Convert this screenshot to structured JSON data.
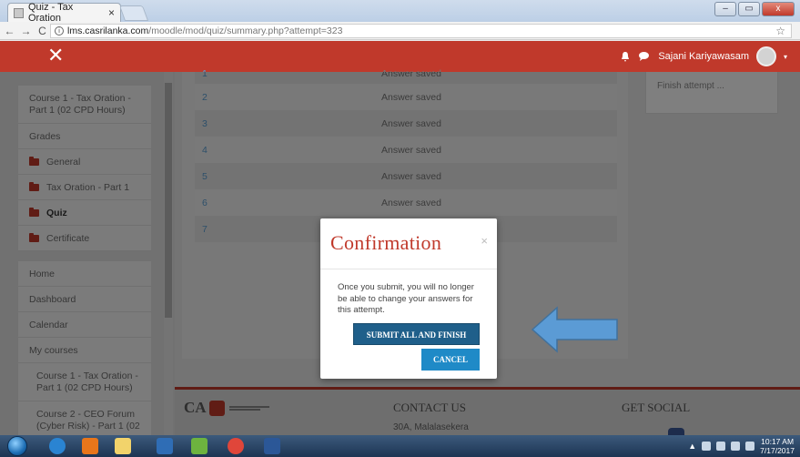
{
  "browser": {
    "tab_title": "Quiz - Tax Oration",
    "tab_close": "×",
    "window_title": "",
    "nav_back": "←",
    "nav_forward": "→",
    "nav_reload": "C",
    "info_glyph": "i",
    "url_domain": "lms.casrilanka.com",
    "url_path": "/moodle/mod/quiz/summary.php?attempt=323",
    "bookmark": "☆",
    "win_min": "–",
    "win_max": "▭",
    "win_close": "x"
  },
  "header": {
    "close_glyph": "✕",
    "username": "Sajani Kariyawasam",
    "caret": "▾",
    "accent": "#c0392b"
  },
  "sidebar": {
    "course_items": [
      {
        "label": "Course 1 - Tax Oration - Part 1 (02 CPD Hours)"
      },
      {
        "label": "Grades"
      },
      {
        "label": "General"
      },
      {
        "label": "Tax Oration - Part 1"
      },
      {
        "label": "Quiz"
      },
      {
        "label": "Certificate"
      }
    ],
    "nav_items": [
      {
        "label": "Home"
      },
      {
        "label": "Dashboard"
      },
      {
        "label": "Calendar"
      },
      {
        "label": "My courses"
      },
      {
        "label": "Course 1 - Tax Oration - Part 1 (02 CPD Hours)"
      },
      {
        "label": "Course 2 - CEO Forum (Cyber Risk) - Part 1 (02"
      }
    ]
  },
  "quiz": {
    "rows": [
      {
        "num": "1",
        "status": "Answer saved"
      },
      {
        "num": "2",
        "status": "Answer saved"
      },
      {
        "num": "3",
        "status": "Answer saved"
      },
      {
        "num": "4",
        "status": "Answer saved"
      },
      {
        "num": "5",
        "status": "Answer saved"
      },
      {
        "num": "6",
        "status": "Answer saved"
      },
      {
        "num": "7",
        "status": ""
      }
    ],
    "finish_attempt": "Finish attempt ..."
  },
  "footer": {
    "logo_text": "CA",
    "contact_heading": "CONTACT US",
    "address": "30A, Malalasekera",
    "social_heading": "GET SOCIAL"
  },
  "modal": {
    "title": "Confirmation",
    "close": "×",
    "body": "Once you submit, you will no longer be able to change your answers for this attempt.",
    "submit_label": "SUBMIT ALL AND FINISH",
    "cancel_label": "CANCEL"
  },
  "taskbar": {
    "time": "10:17 AM",
    "date": "7/17/2017",
    "tray_up": "▲"
  }
}
